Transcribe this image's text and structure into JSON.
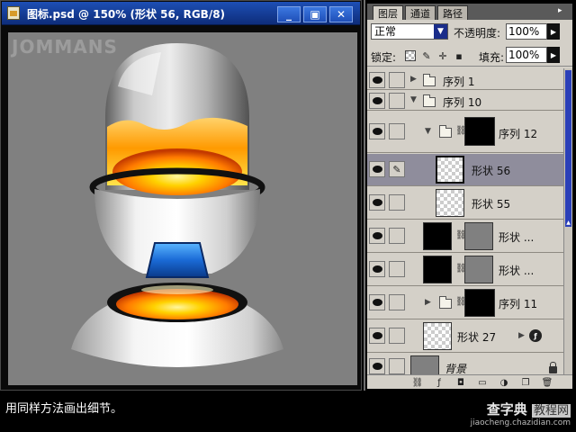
{
  "document": {
    "title": "图标.psd @ 150% (形状 56, RGB/8)",
    "watermark": "JOMMANS",
    "buttons": {
      "minimize": "_",
      "maximize": "▣",
      "close": "✕"
    }
  },
  "layers_panel": {
    "tabs": [
      "图层",
      "通道",
      "路径"
    ],
    "active_tab": "图层",
    "blend_mode": "正常",
    "opacity_label": "不透明度:",
    "opacity_value": "100%",
    "lock_label": "锁定:",
    "fill_label": "填充:",
    "fill_value": "100%",
    "layers": [
      {
        "name": "序列 1",
        "kind": "group",
        "expanded": false,
        "visible": true
      },
      {
        "name": "序列 10",
        "kind": "group",
        "expanded": true,
        "visible": true
      },
      {
        "name": "序列 12",
        "kind": "group-masked",
        "expanded": true,
        "visible": true
      },
      {
        "name": "形状 56",
        "kind": "shape",
        "selected": true,
        "visible": true
      },
      {
        "name": "形状 55",
        "kind": "shape",
        "visible": true
      },
      {
        "name": "形状 ...",
        "kind": "shape-masked",
        "visible": true
      },
      {
        "name": "形状 ...",
        "kind": "shape-masked",
        "visible": true
      },
      {
        "name": "序列 11",
        "kind": "group-masked",
        "expanded": false,
        "visible": true
      },
      {
        "name": "形状 27",
        "kind": "shape-fx",
        "visible": true
      },
      {
        "name": "背景",
        "kind": "background",
        "locked": true,
        "visible": true
      }
    ],
    "bottom_buttons": [
      "link-icon",
      "fx-icon",
      "mask-icon",
      "new-group-icon",
      "adjustment-icon",
      "new-layer-icon",
      "trash-icon"
    ]
  },
  "caption": "用同样方法画出细节。",
  "site_watermark": {
    "main_a": "查字典",
    "main_b": "教程网",
    "url": "jiaocheng.chazidian.com"
  },
  "colors": {
    "titlebar": "#1d4fb5",
    "panel_bg": "#d4d0c8",
    "selected_row": "#8f8d9c",
    "canvas_bg": "#808080",
    "liquid": "#ff9a00",
    "blue_plate": "#1a6ad6"
  }
}
